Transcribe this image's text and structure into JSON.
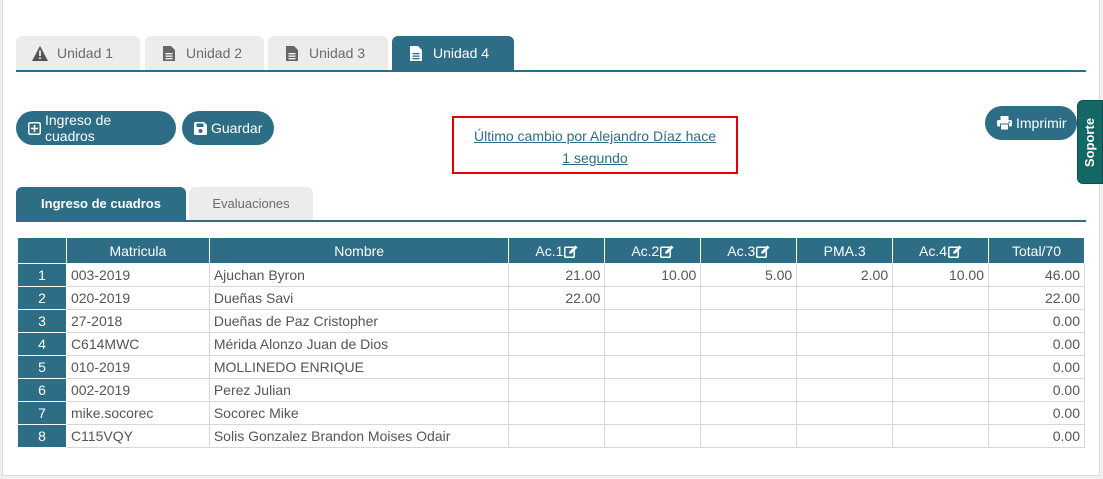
{
  "unit_tabs": [
    {
      "label": "Unidad 1",
      "icon": "warning-icon"
    },
    {
      "label": "Unidad 2",
      "icon": "document-icon"
    },
    {
      "label": "Unidad 3",
      "icon": "document-icon"
    },
    {
      "label": "Unidad 4",
      "icon": "document-icon",
      "active": true
    }
  ],
  "toolbar": {
    "ingreso_label": "Ingreso de cuadros",
    "guardar_label": "Guardar",
    "imprimir_label": "Imprimir"
  },
  "notice": {
    "line1": "Último cambio por Alejandro Díaz hace",
    "line2": "1 segundo"
  },
  "support_label": "Soporte",
  "inner_tabs": [
    {
      "label": "Ingreso de cuadros",
      "active": true
    },
    {
      "label": "Evaluaciones",
      "active": false
    }
  ],
  "table": {
    "headers": [
      "",
      "Matricula",
      "Nombre",
      "Ac.1",
      "Ac.2",
      "Ac.3",
      "PMA.3",
      "Ac.4",
      "Total/70"
    ],
    "rows": [
      [
        "1",
        "003-2019",
        "Ajuchan Byron",
        "21.00",
        "10.00",
        "5.00",
        "2.00",
        "10.00",
        "46.00"
      ],
      [
        "2",
        "020-2019",
        "Dueñas Savi",
        "22.00",
        "",
        "",
        "",
        "",
        "22.00"
      ],
      [
        "3",
        "27-2018",
        "Dueñas de Paz Cristopher",
        "",
        "",
        "",
        "",
        "",
        "0.00"
      ],
      [
        "4",
        "C614MWC",
        "Mérida Alonzo Juan de Dios",
        "",
        "",
        "",
        "",
        "",
        "0.00"
      ],
      [
        "5",
        "010-2019",
        "MOLLINEDO ENRIQUE",
        "",
        "",
        "",
        "",
        "",
        "0.00"
      ],
      [
        "6",
        "002-2019",
        "Perez Julian",
        "",
        "",
        "",
        "",
        "",
        "0.00"
      ],
      [
        "7",
        "mike.socorec",
        "Socorec Mike",
        "",
        "",
        "",
        "",
        "",
        "0.00"
      ],
      [
        "8",
        "C115VQY",
        "Solis Gonzalez Brandon Moises Odair",
        "",
        "",
        "",
        "",
        "",
        "0.00"
      ]
    ]
  },
  "colors": {
    "primary": "#2d6e86",
    "support": "#136765",
    "highlight_border": "#e10000",
    "tab_inactive": "#ececec"
  }
}
